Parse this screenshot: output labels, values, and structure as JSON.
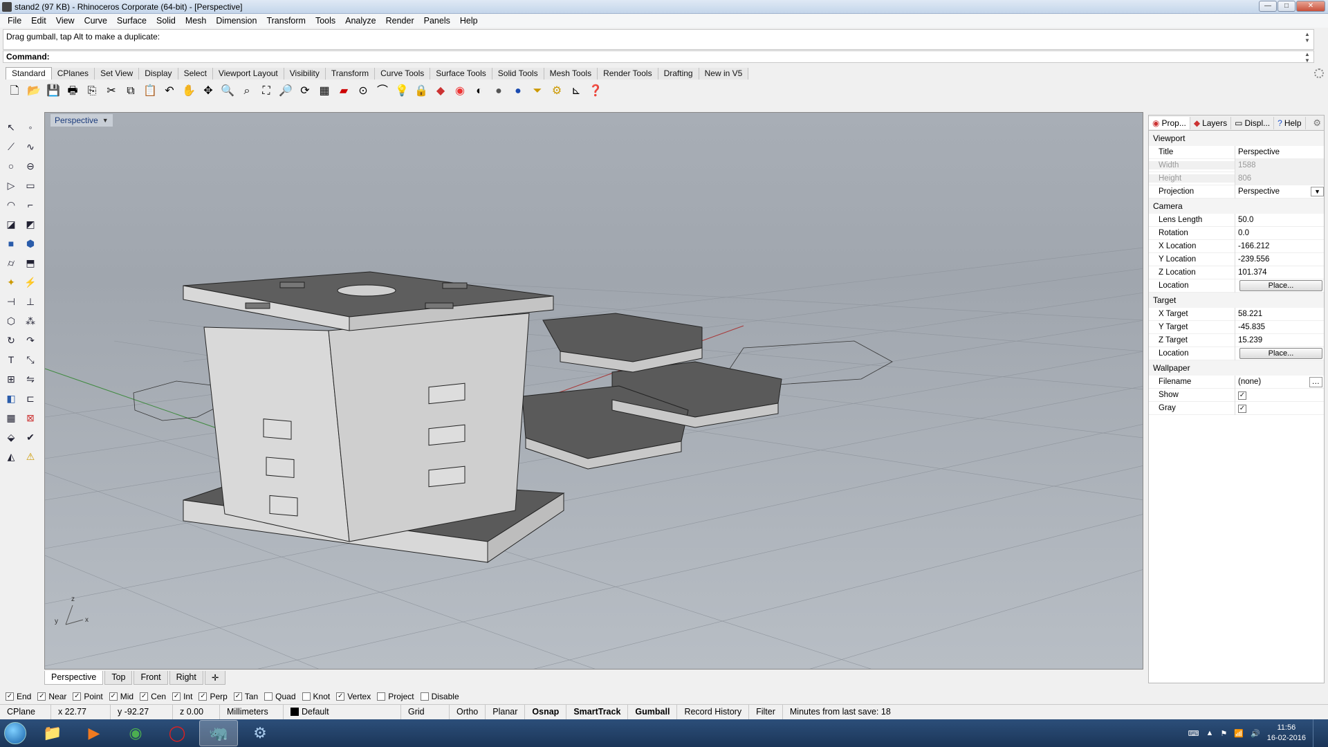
{
  "window": {
    "title": "stand2 (97 KB) - Rhinoceros Corporate (64-bit) - [Perspective]",
    "min": "—",
    "max": "□",
    "close": "✕"
  },
  "menu": [
    "File",
    "Edit",
    "View",
    "Curve",
    "Surface",
    "Solid",
    "Mesh",
    "Dimension",
    "Transform",
    "Tools",
    "Analyze",
    "Render",
    "Panels",
    "Help"
  ],
  "command": {
    "history": "Drag gumball, tap Alt to make a duplicate:",
    "prompt": "Command:"
  },
  "toolbar_tabs": [
    "Standard",
    "CPlanes",
    "Set View",
    "Display",
    "Select",
    "Viewport Layout",
    "Visibility",
    "Transform",
    "Curve Tools",
    "Surface Tools",
    "Solid Tools",
    "Mesh Tools",
    "Render Tools",
    "Drafting",
    "New in V5"
  ],
  "toolbar_icons": [
    "new-icon",
    "open-icon",
    "save-icon",
    "print-icon",
    "import-icon",
    "cut-icon",
    "copy-icon",
    "paste-icon",
    "undo-icon",
    "pan-icon",
    "rotate-icon",
    "zoom-icon",
    "zoom-window-icon",
    "zoom-extents-icon",
    "zoom-selected-icon",
    "rotate-view-icon",
    "grid-icon",
    "car-icon",
    "point-icon",
    "curve-icon",
    "light-icon",
    "lock-icon",
    "layer-icon",
    "color-wheel-icon",
    "shade-icon",
    "render-sphere-icon",
    "blue-sphere-icon",
    "filter-icon",
    "gear-icon",
    "dimension-icon",
    "help-icon"
  ],
  "viewport": {
    "title": "Perspective",
    "axis": {
      "x": "x",
      "y": "y",
      "z": "z"
    }
  },
  "viewport_tabs": [
    "Perspective",
    "Top",
    "Front",
    "Right"
  ],
  "osnaps": [
    {
      "label": "End",
      "checked": true
    },
    {
      "label": "Near",
      "checked": true
    },
    {
      "label": "Point",
      "checked": true
    },
    {
      "label": "Mid",
      "checked": true
    },
    {
      "label": "Cen",
      "checked": true
    },
    {
      "label": "Int",
      "checked": true
    },
    {
      "label": "Perp",
      "checked": true
    },
    {
      "label": "Tan",
      "checked": true
    },
    {
      "label": "Quad",
      "checked": false
    },
    {
      "label": "Knot",
      "checked": false
    },
    {
      "label": "Vertex",
      "checked": true
    },
    {
      "label": "Project",
      "checked": false
    },
    {
      "label": "Disable",
      "checked": false
    }
  ],
  "status": {
    "cplane": "CPlane",
    "x": "x 22.77",
    "y": "y -92.27",
    "z": "z 0.00",
    "units": "Millimeters",
    "layer": "Default",
    "toggles": [
      "Grid Snap",
      "Ortho",
      "Planar",
      "Osnap",
      "SmartTrack",
      "Gumball",
      "Record History",
      "Filter"
    ],
    "save": "Minutes from last save: 18"
  },
  "panel": {
    "tabs": [
      "Prop...",
      "Layers",
      "Displ...",
      "Help"
    ],
    "viewport": {
      "header": "Viewport",
      "title_k": "Title",
      "title_v": "Perspective",
      "width_k": "Width",
      "width_v": "1588",
      "height_k": "Height",
      "height_v": "806",
      "proj_k": "Projection",
      "proj_v": "Perspective"
    },
    "camera": {
      "header": "Camera",
      "lens_k": "Lens Length",
      "lens_v": "50.0",
      "rot_k": "Rotation",
      "rot_v": "0.0",
      "xl_k": "X Location",
      "xl_v": "-166.212",
      "yl_k": "Y Location",
      "yl_v": "-239.556",
      "zl_k": "Z Location",
      "zl_v": "101.374",
      "loc_k": "Location",
      "place": "Place..."
    },
    "target": {
      "header": "Target",
      "xt_k": "X Target",
      "xt_v": "58.221",
      "yt_k": "Y Target",
      "yt_v": "-45.835",
      "zt_k": "Z Target",
      "zt_v": "15.239",
      "loc_k": "Location",
      "place": "Place..."
    },
    "wallpaper": {
      "header": "Wallpaper",
      "file_k": "Filename",
      "file_v": "(none)",
      "show_k": "Show",
      "gray_k": "Gray",
      "show": true,
      "gray": true
    }
  },
  "taskbar": {
    "time": "11:56",
    "date": "16-02-2016"
  }
}
